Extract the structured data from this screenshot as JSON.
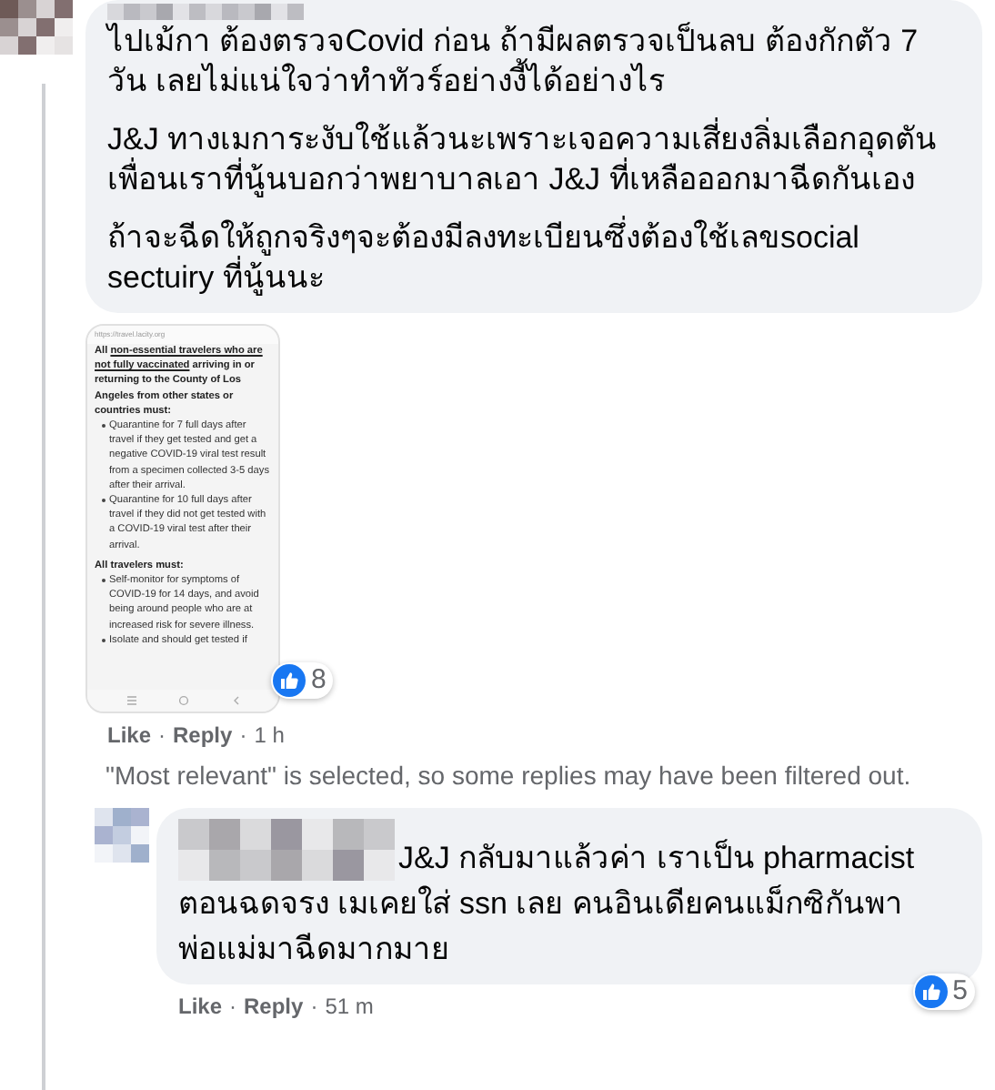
{
  "comment": {
    "paragraphs": [
      [
        "ไปเม้กา ต้องตรวจCovid ก่อน ถ้ามีผลตรวจเป็นลบ ต้องกักตัว 7 วัน เลยไม่แน่ใจว่าทำทัวร์อย่างงี้ได้อย่างไร"
      ],
      [
        "J&J ทางเมการะงับใช้แล้วนะเพราะเจอความเสี่ยงลิ่มเลือกอุดตัน",
        "เพื่อนเราที่นู้นบอกว่าพยาบาลเอา J&J ที่เหลือออกมาฉีดกันเอง"
      ],
      [
        "ถ้าจะฉีดให้ถูกจริงๆจะต้องมีลงทะเบียนซึ่งต้องใช้เลขsocial sectuiry ที่นู้นนะ"
      ]
    ],
    "attachment": {
      "kind": "screenshot",
      "url": "https://travel.lacity.org",
      "sections": [
        {
          "heading": [
            {
              "text": "All ",
              "underlined": false
            },
            {
              "text": "non-essential travelers who are not fully vaccinated",
              "underlined": true
            },
            {
              "text": " arriving in or returning to the County of Los Angeles from other states or countries must:",
              "underlined": false
            }
          ],
          "bullets": [
            "Quarantine for 7 full days after travel if they get tested and get a negative COVID-19 viral test result from a specimen collected 3-5 days after their arrival.",
            "Quarantine for 10 full days after travel if they did not get tested with a COVID-19 viral test after their arrival."
          ]
        },
        {
          "heading": [
            {
              "text": "All travelers must:",
              "underlined": false
            }
          ],
          "bullets": [
            "Self-monitor for symptoms of COVID-19 for 14 days, and avoid being around people who are at increased risk for severe illness.",
            "Isolate and should get tested if"
          ]
        }
      ]
    },
    "reactions": "8",
    "actions": [
      "Like",
      "Reply"
    ],
    "separator": "·",
    "time": "1 h"
  },
  "filter_note": "\"Most relevant\" is selected, so some replies may have been filtered out.",
  "replies": [
    {
      "lines": [
        "J&J กลับมาแล้วค่า เราเป็น pharmacist",
        "ตอนฉดจรง เมเคยใส่ ssn เลย คนอินเดียคนแม็กซิกันพา",
        "พ่อแม่มาฉีดมากมาย"
      ],
      "reactions": "5",
      "actions": [
        "Like",
        "Reply"
      ],
      "separator": "·",
      "time": "51 m"
    }
  ]
}
